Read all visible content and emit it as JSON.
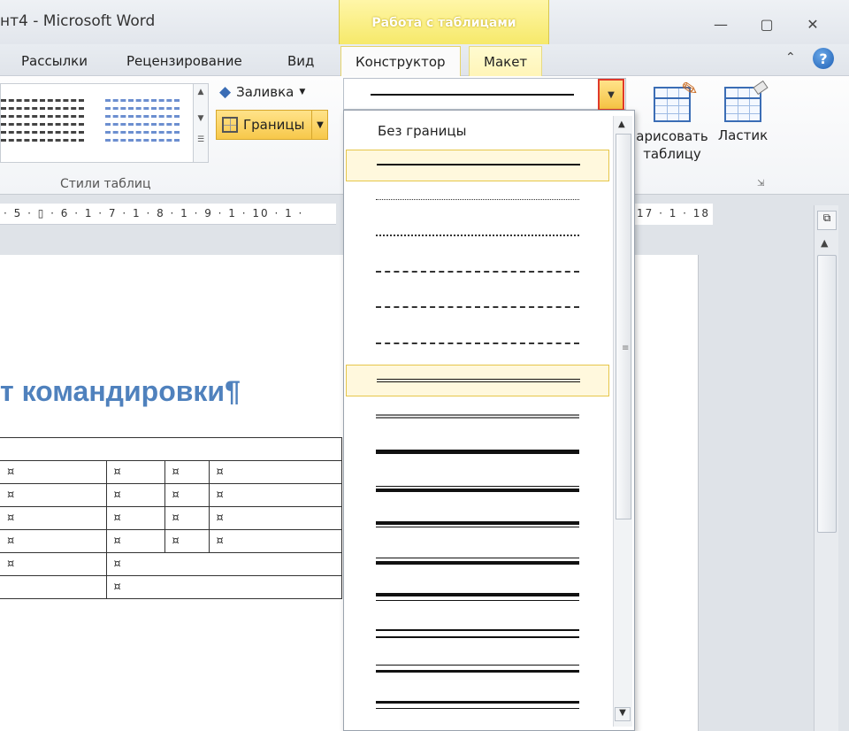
{
  "titlebar": {
    "title": "нт4 - Microsoft Word",
    "context_group": "Работа с таблицами",
    "controls": {
      "minimize": "—",
      "restore": "▢",
      "close": "✕"
    }
  },
  "tabs": {
    "mailings": "Рассылки",
    "review": "Рецензирование",
    "view": "Вид",
    "design": "Конструктор",
    "layout": "Макет",
    "help": "?",
    "collapse": "⌃"
  },
  "ribbon": {
    "table_styles_label": "Стили таблиц",
    "fill_label": "Заливка",
    "borders_label": "Границы",
    "draw_table_label_line1": "арисовать",
    "draw_table_label_line2": "таблицу",
    "eraser_label": "Ластик"
  },
  "ruler": {
    "left": "· 5 · ▯ · 6 · 1 · 7 · 1 · 8 · 1 · 9 · 1 · 10 · 1 ·",
    "right": "17 · 1 · 18"
  },
  "document": {
    "heading": "т командировки¶",
    "cell_mark": "¤"
  },
  "dropdown": {
    "no_border_label": "Без границы",
    "selected_indexes": [
      0,
      6
    ]
  }
}
